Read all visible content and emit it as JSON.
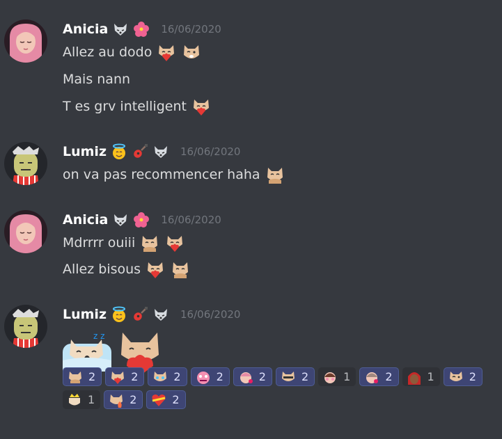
{
  "colors": {
    "background": "#36393f",
    "username": "#ffffff",
    "timestamp": "#72767d",
    "text": "#dcddde",
    "reaction_bg": "#2f3136",
    "reaction_self_bg": "#3e4574"
  },
  "messages": [
    {
      "username": "Anicia",
      "badges": [
        "wolf-badge",
        "hibiscus-badge"
      ],
      "timestamp": "16/06/2020",
      "lines": [
        {
          "text": "Allez au dodo",
          "emotes": [
            "cat-heart-emote",
            "cat-wink-emote"
          ]
        },
        {
          "text": "Mais nann",
          "emotes": []
        },
        {
          "text": "T es grv intelligent",
          "emotes": [
            "cat-heart-emote"
          ]
        }
      ]
    },
    {
      "username": "Lumiz",
      "badges": [
        "halo-smile-badge",
        "guitar-badge",
        "wolf-badge"
      ],
      "timestamp": "16/06/2020",
      "lines": [
        {
          "text": "on va pas recommencer haha",
          "emotes": [
            "cat-hug-emote"
          ]
        }
      ]
    },
    {
      "username": "Anicia",
      "badges": [
        "wolf-badge",
        "hibiscus-badge"
      ],
      "timestamp": "16/06/2020",
      "lines": [
        {
          "text": "Mdrrrr ouiii",
          "emotes": [
            "cat-hug-emote",
            "cat-heart-emote"
          ]
        },
        {
          "text": "Allez bisous",
          "emotes": [
            "cat-heart-emote",
            "cat-hug-emote"
          ]
        }
      ]
    },
    {
      "username": "Lumiz",
      "badges": [
        "halo-smile-badge",
        "guitar-badge",
        "wolf-badge"
      ],
      "timestamp": "16/06/2020",
      "big_emotes": [
        "sleeping-cat-emote",
        "cat-heart-big-emote"
      ],
      "reactions": [
        {
          "emote": "cat-hug-emote",
          "count": "2",
          "me": true
        },
        {
          "emote": "cat-heart-emote",
          "count": "2",
          "me": true
        },
        {
          "emote": "cat-cry-emote",
          "count": "2",
          "me": true
        },
        {
          "emote": "pink-monster-emote",
          "count": "2",
          "me": true
        },
        {
          "emote": "girl-kiss-emote",
          "count": "2",
          "me": true
        },
        {
          "emote": "cat-shades-emote",
          "count": "2",
          "me": true
        },
        {
          "emote": "girl-shy-emote",
          "count": "1",
          "me": false
        },
        {
          "emote": "girl-love-emote",
          "count": "2",
          "me": true
        },
        {
          "emote": "red-hair-girl-emote",
          "count": "1",
          "me": false
        },
        {
          "emote": "cat-wink-emote",
          "count": "2",
          "me": true
        },
        {
          "emote": "crown-cat-emote",
          "count": "1",
          "me": false
        },
        {
          "emote": "cat-fire-emote",
          "count": "2",
          "me": true
        },
        {
          "emote": "heart-emote",
          "count": "2",
          "me": true
        }
      ]
    }
  ]
}
